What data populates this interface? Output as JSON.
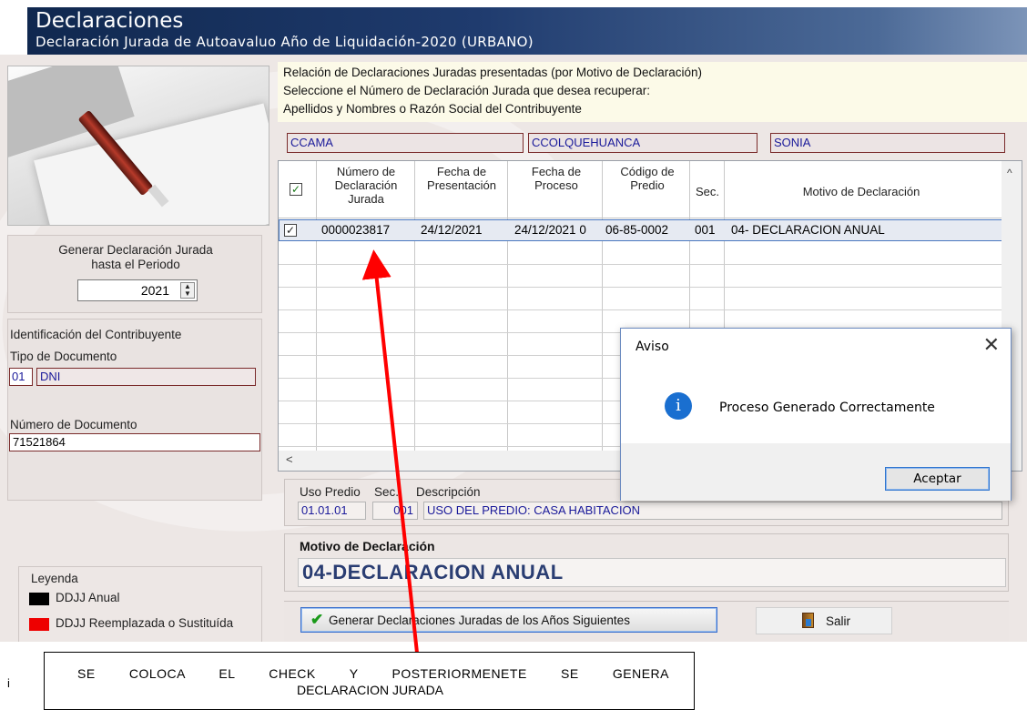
{
  "window": {
    "title": "Declaraciones",
    "subtitle": "Declaración Jurada de Autoavaluo Año de Liquidación-2020 (URBANO)"
  },
  "left": {
    "generar_label_1": "Generar Declaración Jurada",
    "generar_label_2": "hasta el Periodo",
    "year": "2021",
    "id_heading": "Identificación del Contribuyente",
    "tipo_doc_label": "Tipo de Documento",
    "tipo_doc_code": "01",
    "tipo_doc_value": "DNI",
    "num_doc_label": "Número de Documento",
    "num_doc_value": "71521864",
    "legend_heading": "Leyenda",
    "legend_1": "DDJJ Anual",
    "legend_2": "DDJJ Reemplazada o Sustituída",
    "legend_colors": [
      "#000000",
      "#e00000"
    ]
  },
  "info": {
    "line1": "Relación de Declaraciones Juradas presentadas (por Motivo de Declaración)",
    "line2": "Seleccione el Número de Declaración Jurada que desea recuperar:",
    "line3": "Apellidos y Nombres o Razón Social del Contribuyente",
    "name_1": "CCAMA",
    "name_2": "CCOLQUEHUANCA",
    "name_3": "SONIA"
  },
  "grid": {
    "headers": {
      "numero": "Número de Declaración Jurada",
      "fecha_pres": "Fecha de Presentación",
      "fecha_proc": "Fecha de Proceso",
      "codigo": "Código de Predio",
      "sec": "Sec.",
      "motivo": "Motivo de Declaración"
    },
    "rows": [
      {
        "checked": "✓",
        "numero": "0000023817",
        "fecha_pres": "24/12/2021",
        "fecha_proc": "24/12/2021 0",
        "codigo": "06-85-0002",
        "sec": "001",
        "motivo": "04- DECLARACION ANUAL"
      }
    ]
  },
  "uso": {
    "label_uso": "Uso Predio",
    "label_sec": "Sec.",
    "label_desc": "Descripción",
    "uso_val": "01.01.01",
    "sec_val": "001",
    "desc_val": "USO DEL PREDIO: CASA HABITACION"
  },
  "motivo": {
    "label": "Motivo de Declaración",
    "value": "04-DECLARACION ANUAL"
  },
  "buttons": {
    "generar": "Generar Declaraciones Juradas de los Años Siguientes",
    "salir": "Salir"
  },
  "dialog": {
    "title": "Aviso",
    "message": "Proceso Generado Correctamente",
    "ok": "Aceptar"
  },
  "annotation": {
    "line1": "SE COLOCA EL CHECK Y POSTERIORMENETE SE GENERA",
    "line2": "DECLARACION JURADA",
    "stray": "i",
    "arrow_color": "#ff0000"
  }
}
